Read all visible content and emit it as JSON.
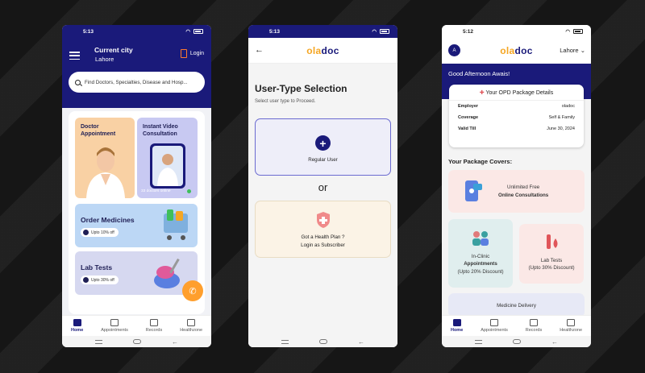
{
  "phone1": {
    "status": {
      "time": "5:13"
    },
    "header": {
      "title": "Current city",
      "city": "Lahore",
      "login_label": "Login"
    },
    "search": {
      "placeholder": "Find Doctors, Specialties, Disease and Hosp..."
    },
    "tiles": {
      "doctor": "Doctor\nAppointment",
      "video": "Instant Video\nConsultation",
      "online_count": "33 doctors online",
      "medicines": "Order Medicines",
      "medicines_chip": "Upto 10% off",
      "lab": "Lab Tests",
      "lab_chip": "Upto 30% off"
    },
    "tabs": [
      {
        "label": "Home",
        "icon": "home-icon",
        "active": true
      },
      {
        "label": "Appointments",
        "icon": "calendar-icon"
      },
      {
        "label": "Records",
        "icon": "records-icon"
      },
      {
        "label": "Healthzone",
        "icon": "heart-icon"
      }
    ]
  },
  "phone2": {
    "status": {
      "time": "5:13"
    },
    "logo": {
      "a": "ola",
      "b": "doc"
    },
    "title": "User-Type Selection",
    "subtitle": "Select user type to Proceed.",
    "regular": "Regular User",
    "or": "or",
    "health_plan_q": "Got a Health Plan ?",
    "health_plan_login": "Login as Subscriber"
  },
  "phone3": {
    "status": {
      "time": "5:12"
    },
    "avatar": "A",
    "logo": {
      "a": "ola",
      "b": "doc"
    },
    "city": "Lahore",
    "greeting": "Good Afternoon Awais!",
    "opd": {
      "title": "Your OPD Package Details",
      "employer_k": "Employer",
      "employer_v": "oladoc",
      "coverage_k": "Coverage",
      "coverage_v": "Self & Family",
      "valid_k": "Valid Till",
      "valid_v": "June 30, 2024"
    },
    "covers_title": "Your Package Covers:",
    "video_1": "Unlimited Free",
    "video_2": "Online Consultations",
    "clinic_1": "In-Clinic",
    "clinic_2": "Appointments",
    "clinic_3": "(Upto 20% Discount)",
    "lab_1": "Lab Tests",
    "lab_2": "(Upto 30% Discount)",
    "med": "Medicine Delivery",
    "tabs": [
      {
        "label": "Home"
      },
      {
        "label": "Appointments"
      },
      {
        "label": "Records"
      },
      {
        "label": "Healthzone"
      }
    ]
  },
  "colors": {
    "navy": "#1a1a7a",
    "orange": "#f5a623",
    "fab": "#ff9f2d"
  }
}
